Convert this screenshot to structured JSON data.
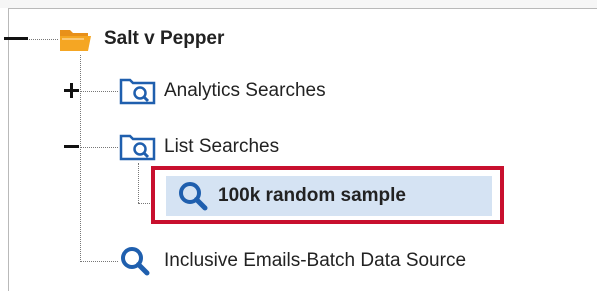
{
  "tree": {
    "root": {
      "label": "Salt v Pepper",
      "expanded": true,
      "icon": "folder-icon"
    },
    "children": [
      {
        "label": "Analytics Searches",
        "expanded": false,
        "icon": "search-folder-icon"
      },
      {
        "label": "List Searches",
        "expanded": true,
        "icon": "search-folder-icon",
        "children": [
          {
            "label": "100k random sample",
            "icon": "search-icon",
            "selected": true
          }
        ]
      },
      {
        "label": "Inclusive Emails-Batch Data Source",
        "icon": "search-icon"
      }
    ]
  },
  "colors": {
    "folder": "#f5a623",
    "search_icon": "#1f5fae",
    "selection_bg": "#d5e3f3",
    "highlight_border": "#c8102e"
  }
}
